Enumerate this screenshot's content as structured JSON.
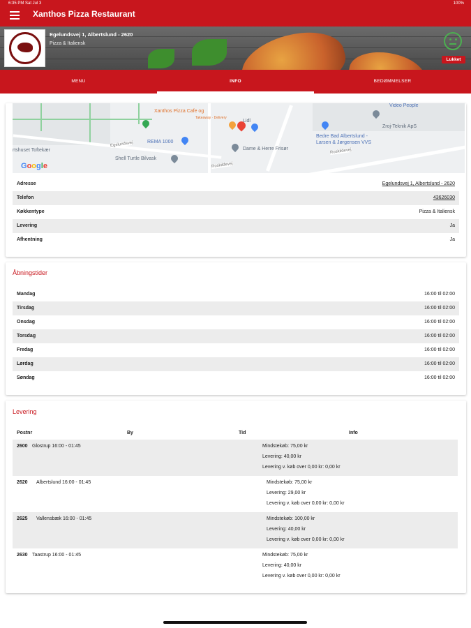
{
  "status": {
    "time": "6:35 PM   Sat Jul 3",
    "battery": "100%"
  },
  "header": {
    "title": "Xanthos Pizza Restaurant"
  },
  "banner": {
    "address": "Egelundsvej 1, Albertslund - 2620",
    "cuisine": "Pizza & Italiensk",
    "status_badge": "Lukket"
  },
  "tabs": [
    "MENU",
    "INFO",
    "BEDØMMELSER"
  ],
  "map": {
    "labels": {
      "xanthos": "Xanthos Pizza Cafe og",
      "xanthos_sub": "Takeaway · Delivery",
      "lidl": "Lidl",
      "rema": "REMA 1000",
      "shell": "Shell Turtle Bilvask",
      "frisor": "Dame & Herre Frisør",
      "toftekaer": "rtshuset Toftekær",
      "elteknik": "Zroj-Teknik ApS",
      "bedrebad": "Bedre Bad Albertslund -",
      "bedrebad2": "Larsen & Jørgensen VVS",
      "videopeople": "Video People",
      "roskildevej1": "Roskildevej",
      "roskildevej2": "Roskildevej",
      "egelundsvej": "Egelundsvej",
      "google": "Google"
    }
  },
  "info": {
    "rows": [
      {
        "label": "Adresse",
        "value": "Egelundsvej 1, Albertslund - 2620",
        "link": true
      },
      {
        "label": "Telefon",
        "value": "43626030",
        "link": true
      },
      {
        "label": "Køkkentype",
        "value": "Pizza & Italiensk",
        "link": false
      },
      {
        "label": "Levering",
        "value": "Ja",
        "link": false
      },
      {
        "label": "Afhentning",
        "value": "Ja",
        "link": false
      }
    ]
  },
  "hours": {
    "title": "Åbningstider",
    "rows": [
      {
        "day": "Mandag",
        "time": "16:00 til 02:00"
      },
      {
        "day": "Tirsdag",
        "time": "16:00 til 02:00"
      },
      {
        "day": "Onsdag",
        "time": "16:00 til 02:00"
      },
      {
        "day": "Torsdag",
        "time": "16:00 til 02:00"
      },
      {
        "day": "Fredag",
        "time": "16:00 til 02:00"
      },
      {
        "day": "Lørdag",
        "time": "16:00 til 02:00"
      },
      {
        "day": "Søndag",
        "time": "16:00 til 02:00"
      }
    ]
  },
  "delivery": {
    "title": "Levering",
    "headers": {
      "postnr": "Postnr",
      "by": "By",
      "tid": "Tid",
      "info": "Info"
    },
    "rows": [
      {
        "postnr": "2600",
        "city": "Glostrup   16:00 - 01:45",
        "min": "Mindstekøb: 75,00 kr",
        "fee": "Levering: 40,00 kr",
        "free": "Levering v. køb over 0,00 kr: 0,00 kr"
      },
      {
        "postnr": "2620",
        "city": "Albertslund   16:00 - 01:45",
        "min": "Mindstekøb: 75,00 kr",
        "fee": "Levering: 29,00 kr",
        "free": "Levering v. køb over 0,00 kr: 0,00 kr"
      },
      {
        "postnr": "2625",
        "city": "Vallensbæk   16:00 - 01:45",
        "min": "Mindstekøb: 100,00 kr",
        "fee": "Levering: 40,00 kr",
        "free": "Levering v. køb over 0,00 kr: 0,00 kr"
      },
      {
        "postnr": "2630",
        "city": "Taastrup   16:00 - 01:45",
        "min": "Mindstekøb: 75,00 kr",
        "fee": "Levering: 40,00 kr",
        "free": "Levering v. køb over 0,00 kr: 0,00 kr"
      }
    ]
  },
  "colors": {
    "brand": "#c8161d",
    "row_alt": "#ececec",
    "open_green": "#4caf50"
  }
}
